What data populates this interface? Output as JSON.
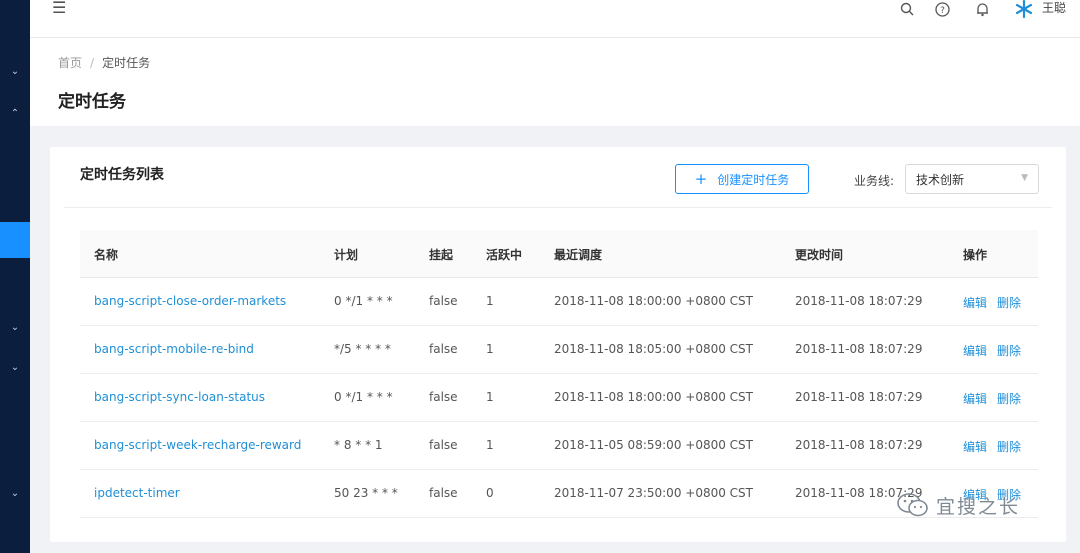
{
  "topbar": {
    "menu_icon": "menu-fold-icon",
    "icons": [
      "search-icon",
      "help-icon",
      "bell-icon"
    ],
    "user": {
      "name": "王聪",
      "avatar_icon": "snowflake-avatar"
    }
  },
  "sidebar": {
    "chevrons": [
      "chevron-down-icon",
      "chevron-up-icon",
      "chevron-down-icon",
      "chevron-down-icon",
      "chevron-down-icon"
    ],
    "active_color": "#1890ff",
    "background": "#0c1e3d"
  },
  "breadcrumb": {
    "home": "首页",
    "separator": "/",
    "current": "定时任务"
  },
  "page_title": "定时任务",
  "card": {
    "title": "定时任务列表",
    "create_button": "创建定时任务",
    "filter_label": "业务线:",
    "filter_value": "技术创新"
  },
  "table": {
    "headers": {
      "name": "名称",
      "plan": "计划",
      "suspend": "挂起",
      "active": "活跃中",
      "last_run": "最近调度",
      "modified": "更改时间",
      "actions": "操作"
    },
    "rows": [
      {
        "name": "bang-script-close-order-markets",
        "plan": "0 */1 * * *",
        "suspend": "false",
        "active": "1",
        "last_run": "2018-11-08 18:00:00 +0800 CST",
        "modified": "2018-11-08 18:07:29",
        "edit": "编辑",
        "delete": "删除"
      },
      {
        "name": "bang-script-mobile-re-bind",
        "plan": "*/5 * * * *",
        "suspend": "false",
        "active": "1",
        "last_run": "2018-11-08 18:05:00 +0800 CST",
        "modified": "2018-11-08 18:07:29",
        "edit": "编辑",
        "delete": "删除"
      },
      {
        "name": "bang-script-sync-loan-status",
        "plan": "0 */1 * * *",
        "suspend": "false",
        "active": "1",
        "last_run": "2018-11-08 18:00:00 +0800 CST",
        "modified": "2018-11-08 18:07:29",
        "edit": "编辑",
        "delete": "删除"
      },
      {
        "name": "bang-script-week-recharge-reward",
        "plan": "* 8 * * 1",
        "suspend": "false",
        "active": "1",
        "last_run": "2018-11-05 08:59:00 +0800 CST",
        "modified": "2018-11-08 18:07:29",
        "edit": "编辑",
        "delete": "删除"
      },
      {
        "name": "ipdetect-timer",
        "plan": "50 23 * * *",
        "suspend": "false",
        "active": "0",
        "last_run": "2018-11-07 23:50:00 +0800 CST",
        "modified": "2018-11-08 18:07:29",
        "edit": "编辑",
        "delete": "删除"
      }
    ]
  },
  "watermark": {
    "text": "宜搜之长",
    "icon": "wechat-icon"
  },
  "colors": {
    "link": "#1f8fd6",
    "primary": "#1890ff"
  }
}
